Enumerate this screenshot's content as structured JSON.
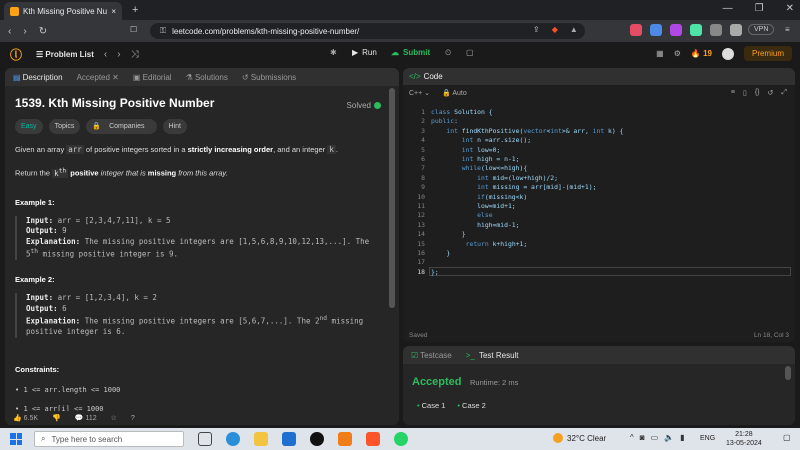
{
  "browser": {
    "tab_title": "Kth Missing Positive Number - L",
    "new_tab": "+",
    "url": "leetcode.com/problems/kth-missing-positive-number/",
    "vpn": "VPN"
  },
  "lc_nav": {
    "problem_list": "Problem List",
    "run": "Run",
    "submit": "Submit",
    "streak": "19",
    "premium": "Premium"
  },
  "left_tabs": [
    "Description",
    "Accepted",
    "Editorial",
    "Solutions",
    "Submissions"
  ],
  "problem": {
    "title": "1539. Kth Missing Positive Number",
    "solved": "Solved",
    "tags": [
      "Easy",
      "Topics",
      "Companies",
      "Hint"
    ],
    "desc_pre": "Given an array ",
    "desc_arr": "arr",
    "desc_mid": " of positive integers sorted in a ",
    "desc_bold": "strictly increasing order",
    "desc_post": ", and an integer ",
    "desc_k": "k",
    "desc_end": ".",
    "return_pre": "Return the ",
    "return_k": "k",
    "return_th": "th",
    "return_bold": "positive",
    "return_mid": " integer that is ",
    "return_bold2": "missing",
    "return_end": " from this array.",
    "examples": [
      {
        "heading": "Example 1:",
        "input_label": "Input:",
        "input": "arr = [2,3,4,7,11], k = 5",
        "output_label": "Output:",
        "output": "9",
        "expl_label": "Explanation:",
        "expl": "The missing positive integers are [1,5,6,8,9,10,12,13,...]. The",
        "expl2_pre": "5",
        "expl2_sup": "th",
        "expl2_post": " missing positive integer is 9."
      },
      {
        "heading": "Example 2:",
        "input_label": "Input:",
        "input": "arr = [1,2,3,4], k = 2",
        "output_label": "Output:",
        "output": "6",
        "expl_label": "Explanation:",
        "expl": "The missing positive integers are [5,6,7,...]. The 2",
        "expl_sup": "nd",
        "expl_post": " missing",
        "expl2_post": "positive integer is 6."
      }
    ],
    "constraints_heading": "Constraints:",
    "constraints": [
      "1 <= arr.length <= 1000",
      "1 <= arr[i] <= 1000"
    ],
    "likes": "6.5K",
    "comments": "112"
  },
  "code_panel": {
    "header": "Code",
    "language": "C++",
    "mode": "Auto",
    "saved": "Saved",
    "cursor": "Ln 18, Col 3",
    "lines": [
      "class Solution {",
      "public:",
      "    int findKthPositive(vector<int>& arr, int k) {",
      "        int n =arr.size();",
      "        int low=0;",
      "        int high = n-1;",
      "        while(low<=high){",
      "            int mid=(low+high)/2;",
      "            int missing = arr[mid]-(mid+1);",
      "            if(missing<k)",
      "            low=mid+1;",
      "            else",
      "            high=mid-1;",
      "        }",
      "         return k+high+1;",
      "    }",
      "",
      "};"
    ]
  },
  "test_panel": {
    "tabs": [
      "Testcase",
      "Test Result"
    ],
    "status": "Accepted",
    "runtime": "Runtime: 2 ms",
    "cases": [
      "Case 1",
      "Case 2"
    ]
  },
  "taskbar": {
    "search_placeholder": "Type here to search",
    "weather": "32°C  Clear",
    "lang": "ENG",
    "time": "21:28",
    "date": "13-05-2024"
  }
}
